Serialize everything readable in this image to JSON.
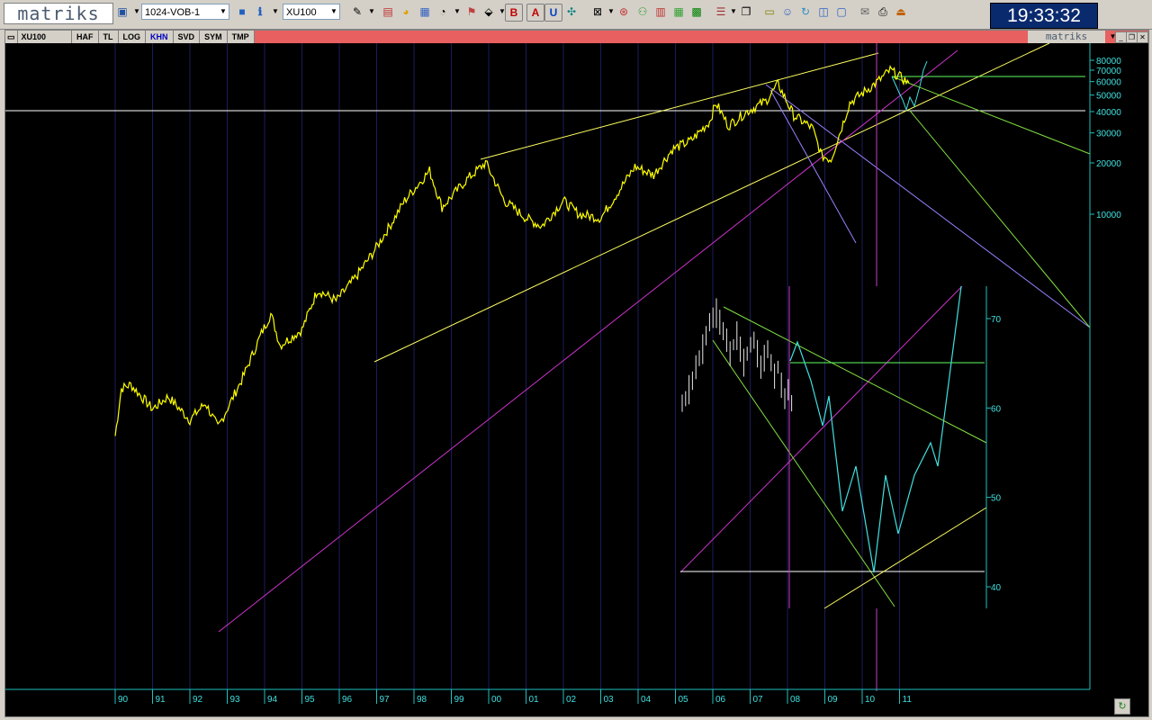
{
  "app": {
    "logo": "matriks",
    "layout_combo": "1024-VOB-1",
    "symbol_combo": "XU100",
    "clock": "19:33:32"
  },
  "chart_window": {
    "symbol": "XU100",
    "tabs": [
      {
        "label": "HAF",
        "active": false
      },
      {
        "label": "TL",
        "active": false
      },
      {
        "label": "LOG",
        "active": false
      },
      {
        "label": "KHN",
        "active": true
      },
      {
        "label": "SVD",
        "active": false
      },
      {
        "label": "SYM",
        "active": false
      },
      {
        "label": "TMP",
        "active": false
      }
    ],
    "brand": "matriks",
    "controls": [
      "▼",
      "_",
      "❐",
      "✕"
    ]
  },
  "chart_data": [
    {
      "type": "line",
      "series": [
        {
          "color": "#ffff00"
        }
      ],
      "x_ticks": [
        "90",
        "91",
        "92",
        "93",
        "94",
        "95",
        "96",
        "97",
        "98",
        "99",
        "00",
        "01",
        "02",
        "03",
        "04",
        "05",
        "06",
        "07",
        "08",
        "09",
        "10",
        "11"
      ],
      "y_scale": "log",
      "y_ticks": [
        10000,
        20000,
        30000,
        40000,
        50000,
        60000,
        70000,
        80000
      ],
      "y_tick_labels": [
        "10000",
        "20000",
        "30000",
        "40000",
        "50000",
        "60000",
        "70000",
        "80000"
      ],
      "approx_points": [
        [
          "1990-01",
          500
        ],
        [
          "1990-03",
          950
        ],
        [
          "1990-06",
          1000
        ],
        [
          "1991-01",
          720
        ],
        [
          "1991-06",
          850
        ],
        [
          "1992-01",
          620
        ],
        [
          "1992-06",
          780
        ],
        [
          "1992-10",
          560
        ],
        [
          "1993-06",
          1100
        ],
        [
          "1993-12",
          2000
        ],
        [
          "1994-03",
          2600
        ],
        [
          "1994-06",
          1700
        ],
        [
          "1995-01",
          2100
        ],
        [
          "1995-06",
          3600
        ],
        [
          "1995-12",
          3100
        ],
        [
          "1996-06",
          4200
        ],
        [
          "1996-12",
          6000
        ],
        [
          "1997-06",
          9000
        ],
        [
          "1997-10",
          12000
        ],
        [
          "1998-06",
          18000
        ],
        [
          "1998-10",
          11000
        ],
        [
          "1999-06",
          16000
        ],
        [
          "1999-12",
          20000
        ],
        [
          "2000-01",
          18500
        ],
        [
          "2000-06",
          12000
        ],
        [
          "2001-01",
          9500
        ],
        [
          "2001-06",
          8500
        ],
        [
          "2002-01",
          12000
        ],
        [
          "2002-06",
          10000
        ],
        [
          "2003-01",
          9500
        ],
        [
          "2003-12",
          19000
        ],
        [
          "2004-06",
          17000
        ],
        [
          "2004-12",
          24000
        ],
        [
          "2005-06",
          27000
        ],
        [
          "2005-12",
          35000
        ],
        [
          "2006-02",
          45000
        ],
        [
          "2006-06",
          33000
        ],
        [
          "2006-12",
          40000
        ],
        [
          "2007-06",
          46000
        ],
        [
          "2007-10",
          58000
        ],
        [
          "2008-03",
          38000
        ],
        [
          "2008-09",
          32000
        ],
        [
          "2008-12",
          22000
        ],
        [
          "2009-03",
          21000
        ],
        [
          "2009-09",
          45000
        ],
        [
          "2010-06",
          60000
        ],
        [
          "2010-10",
          70000
        ],
        [
          "2011-01",
          64000
        ],
        [
          "2011-04",
          59000
        ]
      ]
    },
    {
      "type": "line",
      "y_ticks": [
        40,
        50,
        60,
        70
      ],
      "y_tick_labels": [
        "40",
        "50",
        "60",
        "70"
      ]
    }
  ]
}
